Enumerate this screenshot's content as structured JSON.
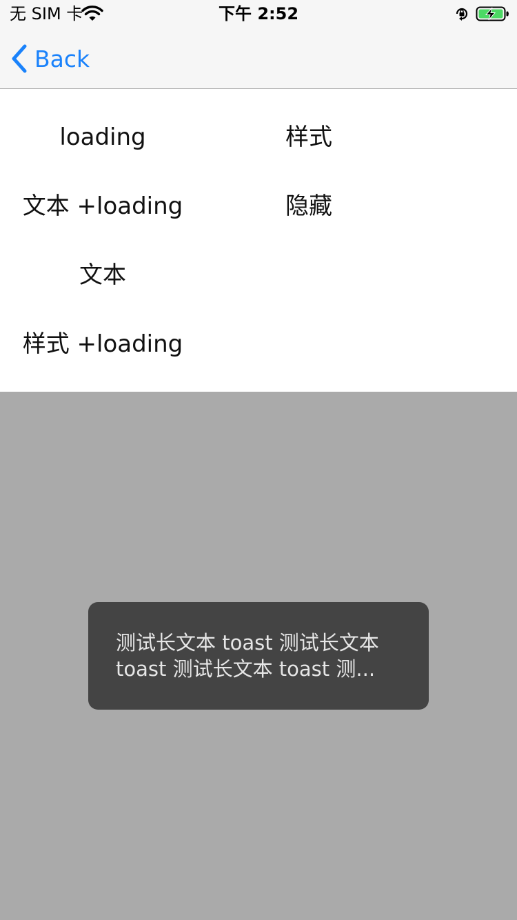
{
  "status_bar": {
    "carrier": "无 SIM 卡",
    "time": "下午 2:52",
    "icons": [
      "wifi-icon",
      "orientation-lock-icon",
      "battery-charging-icon"
    ],
    "battery_color": "#4cd964"
  },
  "nav": {
    "back_label": "Back",
    "accent_color": "#1a82fb"
  },
  "menu": {
    "left": [
      "loading",
      "文本 +loading",
      "文本",
      "样式 +loading"
    ],
    "right": [
      "样式",
      "隐藏"
    ]
  },
  "toast": {
    "line1": "测试长文本 toast 测试长文本",
    "line2": "toast 测试长文本 toast 测..."
  }
}
